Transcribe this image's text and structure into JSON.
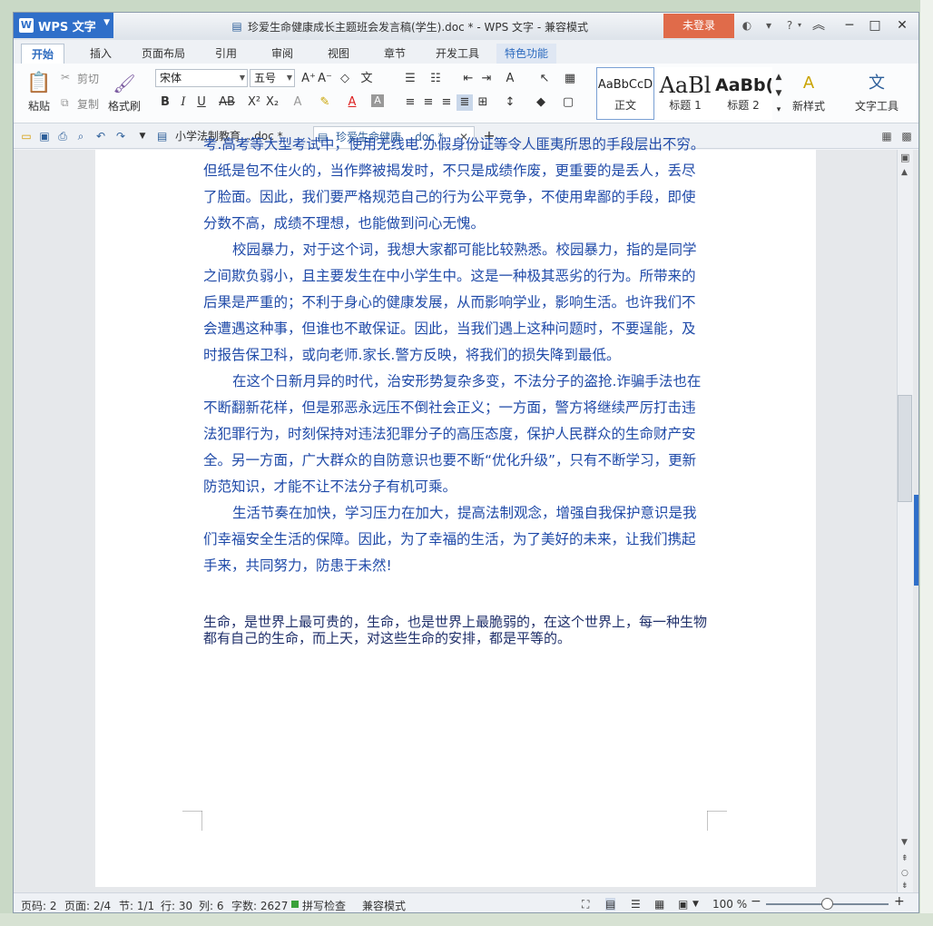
{
  "titlebar": {
    "app_button": "WPS 文字",
    "document_title": "珍爱生命健康成长主题班会发言稿(学生).doc * - WPS 文字 - 兼容模式",
    "login_button": "未登录"
  },
  "menu_tabs": [
    "开始",
    "插入",
    "页面布局",
    "引用",
    "审阅",
    "视图",
    "章节",
    "开发工具",
    "特色功能"
  ],
  "ribbon": {
    "paste": "粘贴",
    "cut": "剪切",
    "copy": "复制",
    "format_painter": "格式刷",
    "font_name": "宋体",
    "font_size": "五号",
    "styles": [
      {
        "sample": "AaBbCcD",
        "name": "正文"
      },
      {
        "sample": "AaBl",
        "name": "标题 1"
      },
      {
        "sample": "AaBb(",
        "name": "标题 2"
      }
    ],
    "new_style": "新样式",
    "text_tools": "文字工具"
  },
  "doc_tabs": [
    {
      "label": "小学法制教育....doc *"
    },
    {
      "label": "珍爱生命健康....doc *"
    }
  ],
  "document": {
    "paragraphs": [
      "考.高考等大型考试中，使用无线电.办假身份证等令人匪夷所思的手段层出不穷。但纸是包不住火的，当作弊被揭发时，不只是成绩作废，更重要的是丢人，丢尽了脸面。因此，我们要严格规范自己的行为公平竞争，不使用卑鄙的手段，即使分数不高，成绩不理想，也能做到问心无愧。",
      "校园暴力，对于这个词，我想大家都可能比较熟悉。校园暴力，指的是同学之间欺负弱小，且主要发生在中小学生中。这是一种极其恶劣的行为。所带来的后果是严重的；不利于身心的健康发展，从而影响学业，影响生活。也许我们不会遭遇这种事，但谁也不敢保证。因此，当我们遇上这种问题时，不要逞能，及时报告保卫科，或向老师.家长.警方反映，将我们的损失降到最低。",
      "在这个日新月异的时代，治安形势复杂多变，不法分子的盗抢.诈骗手法也在不断翻新花样，但是邪恶永远压不倒社会正义；一方面，警方将继续严厉打击违法犯罪行为，时刻保持对违法犯罪分子的高压态度，保护人民群众的生命财产安全。另一方面，广大群众的自防意识也要不断“优化升级”，只有不断学习，更新防范知识，才能不让不法分子有机可乘。",
      "生活节奏在加快，学习压力在加大，提高法制观念，增强自我保护意识是我们幸福安全生活的保障。因此，为了幸福的生活，为了美好的未来，让我们携起手来，共同努力，防患于未然!"
    ],
    "last_paragraph": "生命，是世界上最可贵的，生命，也是世界上最脆弱的，在这个世界上，每一种生物都有自己的生命，而上天，对这些生命的安排，都是平等的。"
  },
  "statusbar": {
    "page_num": "页码: 2",
    "pages": "页面: 2/4",
    "section": "节: 1/1",
    "line": "行: 30",
    "column": "列: 6",
    "word_count": "字数: 2627",
    "spell_check": "拼写检查",
    "compat_mode": "兼容模式",
    "zoom": "100 %"
  }
}
